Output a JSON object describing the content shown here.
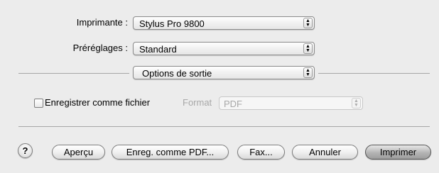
{
  "printer": {
    "label": "Imprimante :",
    "value": "Stylus Pro 9800"
  },
  "presets": {
    "label": "Préréglages :",
    "value": "Standard"
  },
  "section": {
    "value": "Options de sortie"
  },
  "save_to_file": {
    "label": "Enregistrer comme fichier",
    "checked": false,
    "format_label": "Format",
    "format_value": "PDF"
  },
  "buttons": {
    "help": "?",
    "preview": "Aperçu",
    "save_pdf": "Enreg. comme PDF...",
    "fax": "Fax...",
    "cancel": "Annuler",
    "print": "Imprimer"
  },
  "icons": {
    "popup_arrows": "up-down-arrows-icon"
  }
}
